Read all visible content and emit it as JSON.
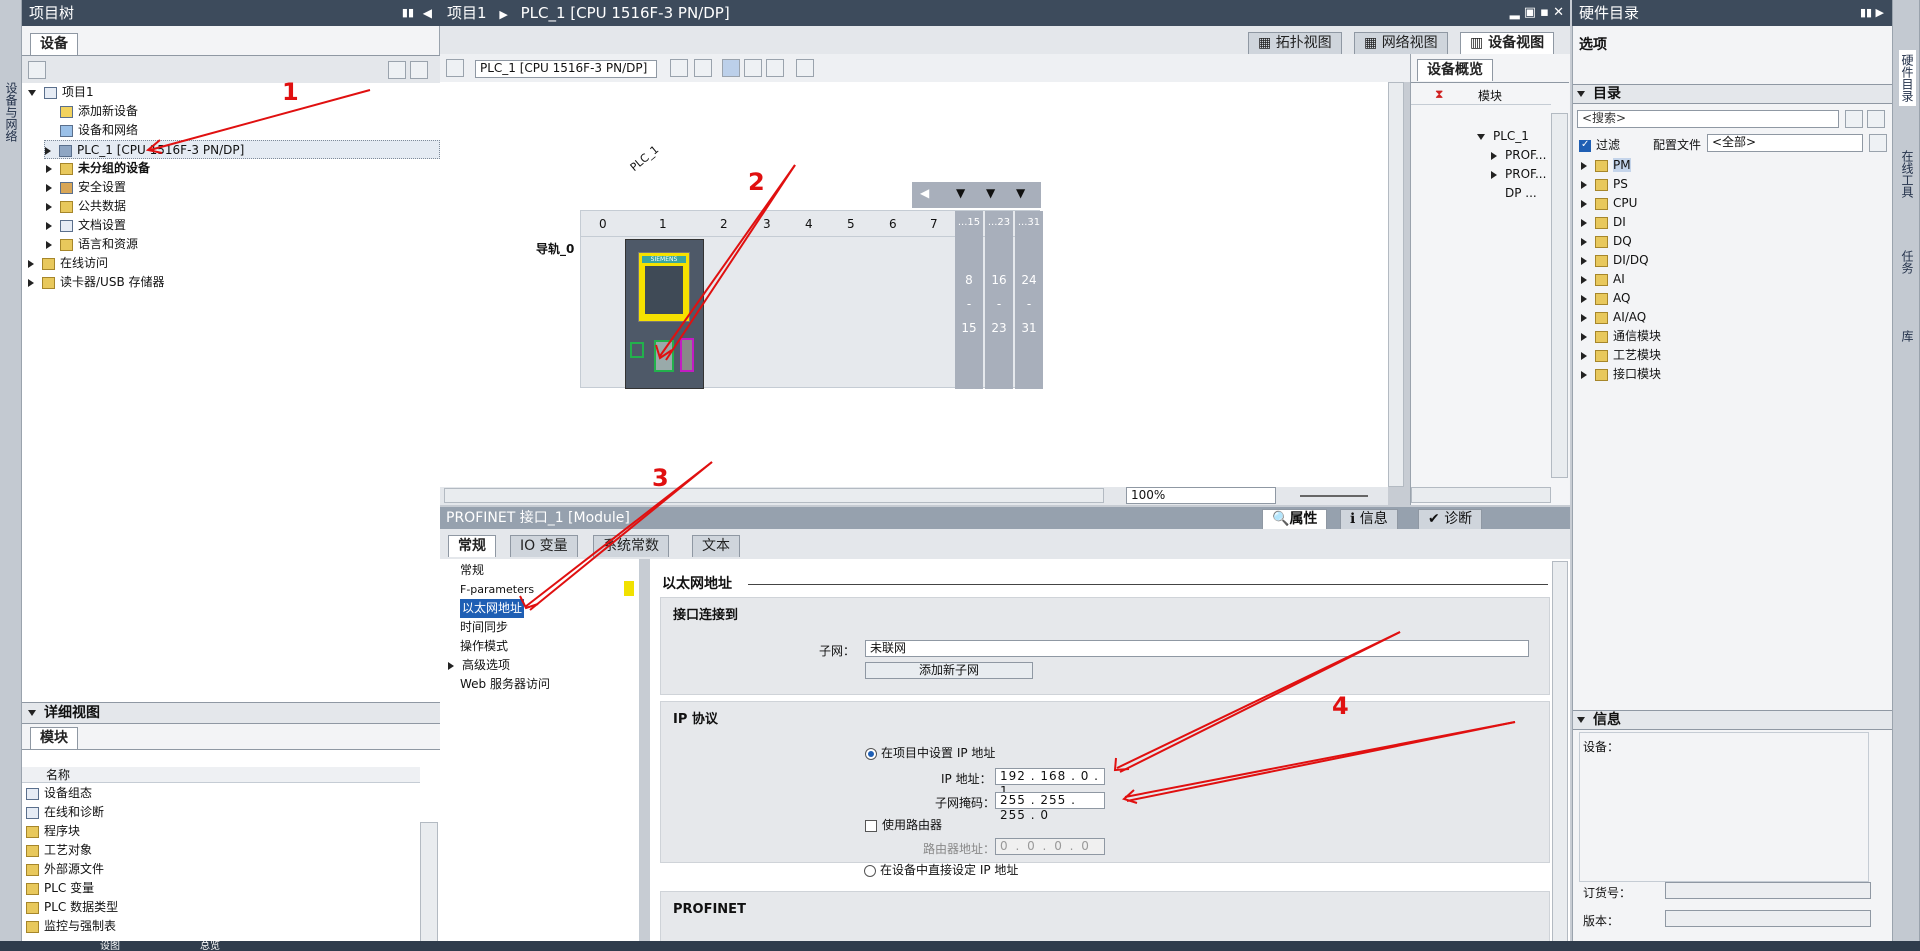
{
  "left_sidebar": {
    "vertical_tab": "设备与网络"
  },
  "project_tree": {
    "title": "项目树",
    "tab": "设备",
    "items": [
      {
        "label": "项目1",
        "level": 0,
        "expanded": true
      },
      {
        "label": "添加新设备",
        "level": 1
      },
      {
        "label": "设备和网络",
        "level": 1
      },
      {
        "label": "PLC_1 [CPU 1516F-3 PN/DP]",
        "level": 1,
        "expanded": false
      },
      {
        "label": "未分组的设备",
        "level": 1,
        "expanded": false
      },
      {
        "label": "安全设置",
        "level": 1,
        "expanded": false
      },
      {
        "label": "公共数据",
        "level": 1,
        "expanded": false
      },
      {
        "label": "文档设置",
        "level": 1,
        "expanded": false
      },
      {
        "label": "语言和资源",
        "level": 1,
        "expanded": false
      },
      {
        "label": "在线访问",
        "level": 0,
        "expanded": false
      },
      {
        "label": "读卡器/USB 存储器",
        "level": 0,
        "expanded": false
      }
    ]
  },
  "detail_view": {
    "title": "详细视图",
    "tab": "模块",
    "column": "名称",
    "items": [
      "设备组态",
      "在线和诊断",
      "程序块",
      "工艺对象",
      "外部源文件",
      "PLC 变量",
      "PLC 数据类型",
      "监控与强制表"
    ]
  },
  "editor": {
    "breadcrumb": [
      "项目1",
      "PLC_1 [CPU 1516F-3 PN/DP]"
    ],
    "view_tabs": [
      "拓扑视图",
      "网络视图",
      "设备视图"
    ],
    "device_select": "PLC_1 [CPU 1516F-3 PN/DP]",
    "device_label": "PLC_1",
    "rail_label": "导轨_0",
    "slots": [
      "0",
      "1",
      "2",
      "3",
      "4",
      "5",
      "6",
      "7",
      "...15",
      "...23",
      "...31"
    ],
    "io_ranges": [
      [
        "8",
        "-",
        "15"
      ],
      [
        "16",
        "-",
        "23"
      ],
      [
        "24",
        "-",
        "31"
      ]
    ],
    "cpu_brand": "SIEMENS",
    "zoom": "100%",
    "overview": {
      "tab": "设备概览",
      "column": "模块",
      "rows": [
        "PLC_1",
        "PROF...",
        "PROF...",
        "DP ..."
      ]
    }
  },
  "inspector": {
    "title": "PROFINET 接口_1 [Module]",
    "right_tabs": [
      "属性",
      "信息",
      "诊断"
    ],
    "tabs": [
      "常规",
      "IO 变量",
      "系统常数",
      "文本"
    ],
    "nav": [
      "常规",
      "F-parameters",
      "以太网地址",
      "时间同步",
      "操作模式",
      "高级选项",
      "Web 服务器访问"
    ],
    "selected_nav": "以太网地址",
    "heading": "以太网地址",
    "interface_section": {
      "title": "接口连接到",
      "subnet_label": "子网：",
      "subnet_value": "未联网",
      "add_subnet_button": "添加新子网"
    },
    "ip_section": {
      "title": "IP 协议",
      "set_in_project": "在项目中设置 IP 地址",
      "ip_label": "IP 地址：",
      "ip": [
        "192",
        "168",
        "0",
        "1"
      ],
      "mask_label": "子网掩码：",
      "mask": [
        "255",
        "255",
        "255",
        "0"
      ],
      "use_router": "使用路由器",
      "router_label": "路由器地址：",
      "router": [
        "0",
        "0",
        "0",
        "0"
      ],
      "set_on_device": "在设备中直接设定 IP 地址"
    },
    "profinet_section": {
      "title": "PROFINET"
    }
  },
  "hardware_catalog": {
    "title": "硬件目录",
    "options": "选项",
    "catalog_title": "目录",
    "search_placeholder": "<搜索>",
    "filter_label": "过滤",
    "profile_label": "配置文件",
    "profile_value": "<全部>",
    "items": [
      "PM",
      "PS",
      "CPU",
      "DI",
      "DQ",
      "DI/DQ",
      "AI",
      "AQ",
      "AI/AQ",
      "通信模块",
      "工艺模块",
      "接口模块"
    ]
  },
  "info_panel": {
    "title": "信息",
    "device_label": "设备：",
    "order_label": "订货号：",
    "version_label": "版本："
  },
  "right_sidebar": {
    "vertical_tabs": [
      "硬件目录",
      "在线工具",
      "任务",
      "库"
    ]
  },
  "bottom_bar": {
    "items": [
      "设图",
      "总览"
    ]
  },
  "annotations": [
    "1",
    "2",
    "3",
    "4"
  ],
  "colors": {
    "title_bar": "#3d4b5c",
    "selection": "#1f5fb4",
    "annotation": "#e01010"
  }
}
